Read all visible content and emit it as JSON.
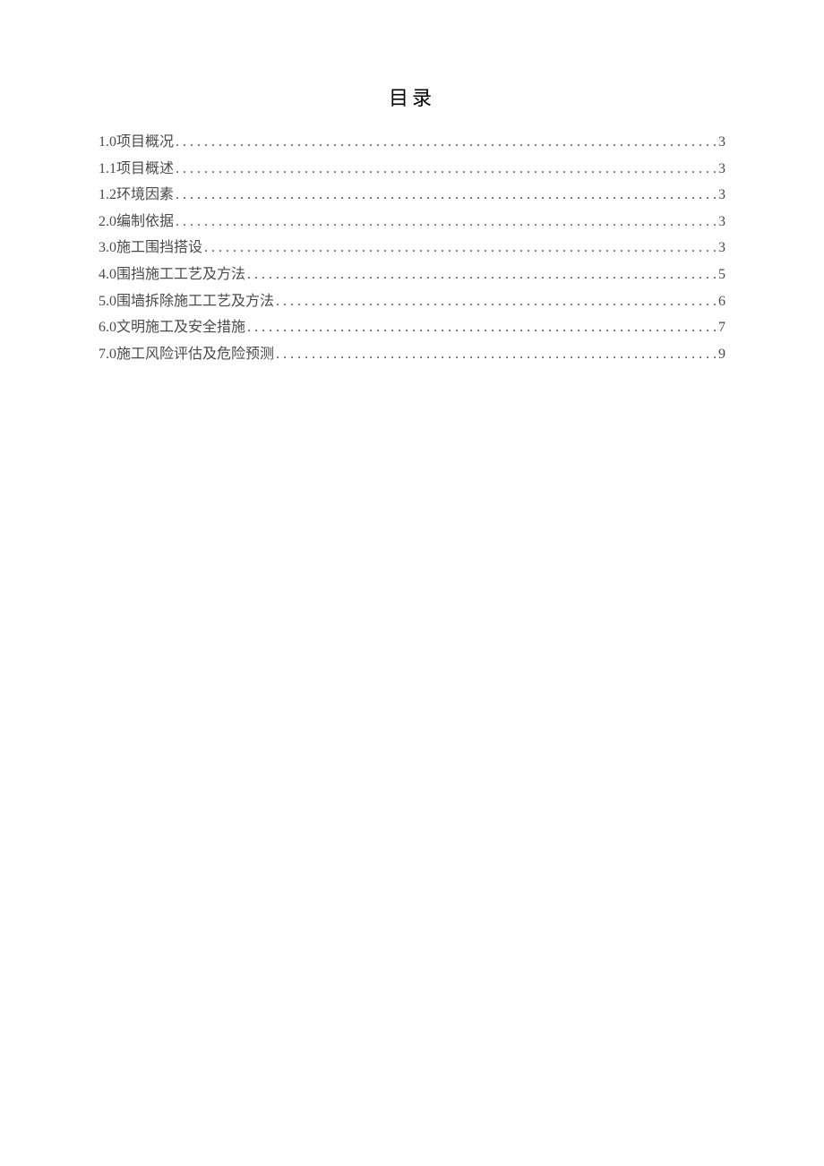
{
  "title": "目录",
  "toc": [
    {
      "label": "1.0项目概况",
      "page": "3"
    },
    {
      "label": "1.1项目概述",
      "page": "3"
    },
    {
      "label": "1.2环境因素",
      "page": "3"
    },
    {
      "label": "2.0编制依据",
      "page": "3"
    },
    {
      "label": "3.0施工围挡搭设",
      "page": "3"
    },
    {
      "label": "4.0围挡施工工艺及方法",
      "page": "5"
    },
    {
      "label": "5.0围墙拆除施工工艺及方法",
      "page": "6"
    },
    {
      "label": "6.0文明施工及安全措施",
      "page": "7"
    },
    {
      "label": "7.0施工风险评估及危险预测",
      "page": "9"
    }
  ]
}
